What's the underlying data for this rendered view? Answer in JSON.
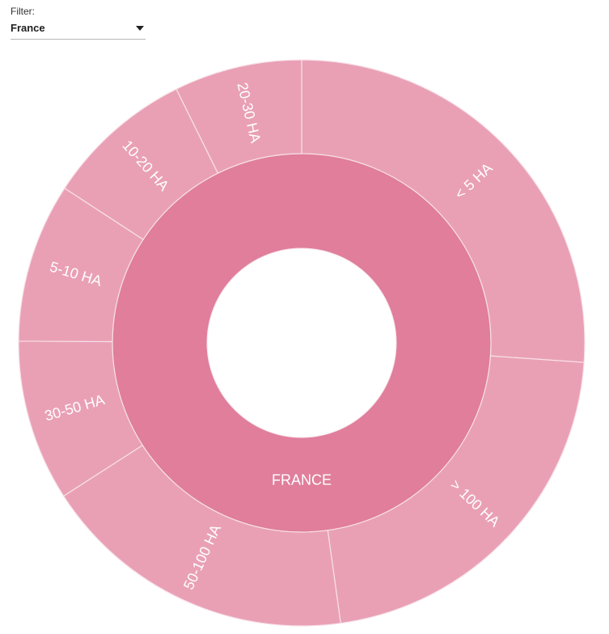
{
  "filter": {
    "label": "Filter:",
    "value": "France"
  },
  "chart_data": {
    "type": "sunburst",
    "colors": {
      "inner": "#e07e9b",
      "outer": "#e9a0b5",
      "separator": "#f7e1e8"
    },
    "root": {
      "name": "FRANCE",
      "value": 100
    },
    "children": [
      {
        "name": "< 5 HA",
        "share_pct": 26.1
      },
      {
        "name": "> 100 HA",
        "share_pct": 21.7
      },
      {
        "name": "50-100 HA",
        "share_pct": 18.1
      },
      {
        "name": "30-50 HA",
        "share_pct": 9.2
      },
      {
        "name": "5-10 HA",
        "share_pct": 9.1
      },
      {
        "name": "10-20 HA",
        "share_pct": 8.5
      },
      {
        "name": "20-30 HA",
        "share_pct": 7.3
      }
    ]
  }
}
